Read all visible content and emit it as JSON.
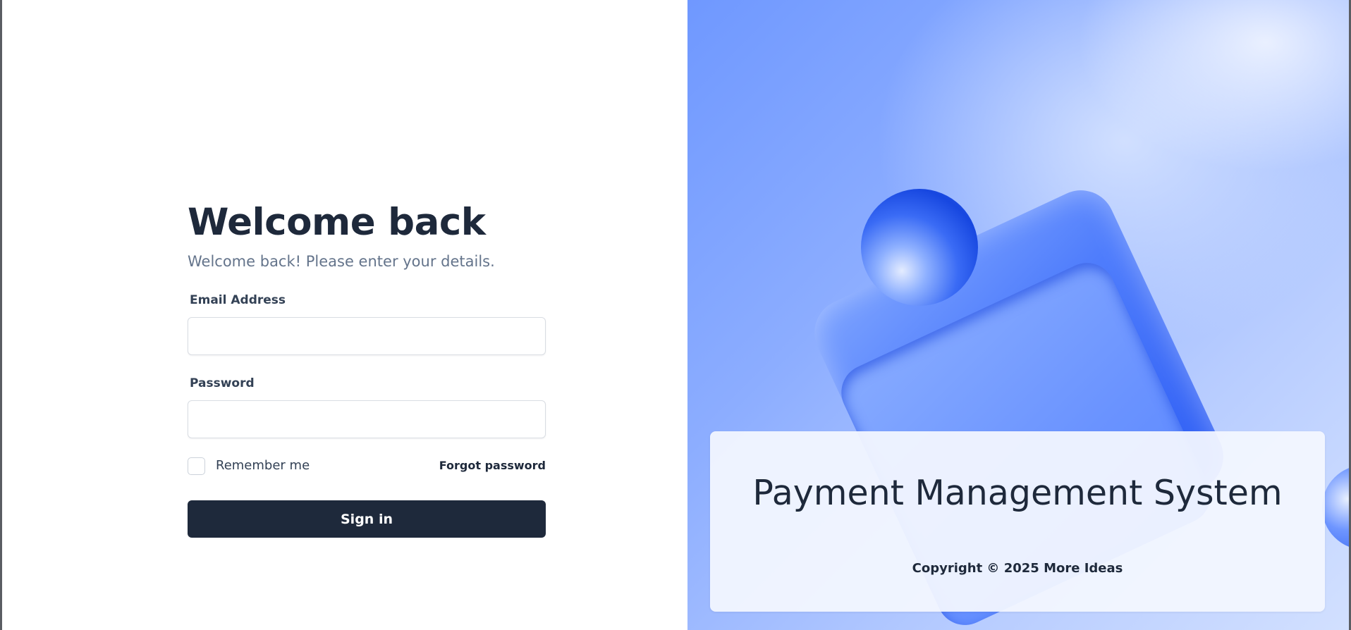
{
  "login": {
    "title": "Welcome back",
    "subtitle": "Welcome back! Please enter your details.",
    "email_label": "Email Address",
    "email_value": "",
    "password_label": "Password",
    "password_value": "",
    "remember_label": "Remember me",
    "remember_checked": false,
    "forgot_label": "Forgot password",
    "signin_label": "Sign in"
  },
  "hero": {
    "title": "Payment Management System",
    "copyright": "Copyright © 2025 More Ideas"
  },
  "colors": {
    "primary": "#1e293b",
    "muted": "#64748b",
    "hero_blue": "#6f98ff"
  }
}
